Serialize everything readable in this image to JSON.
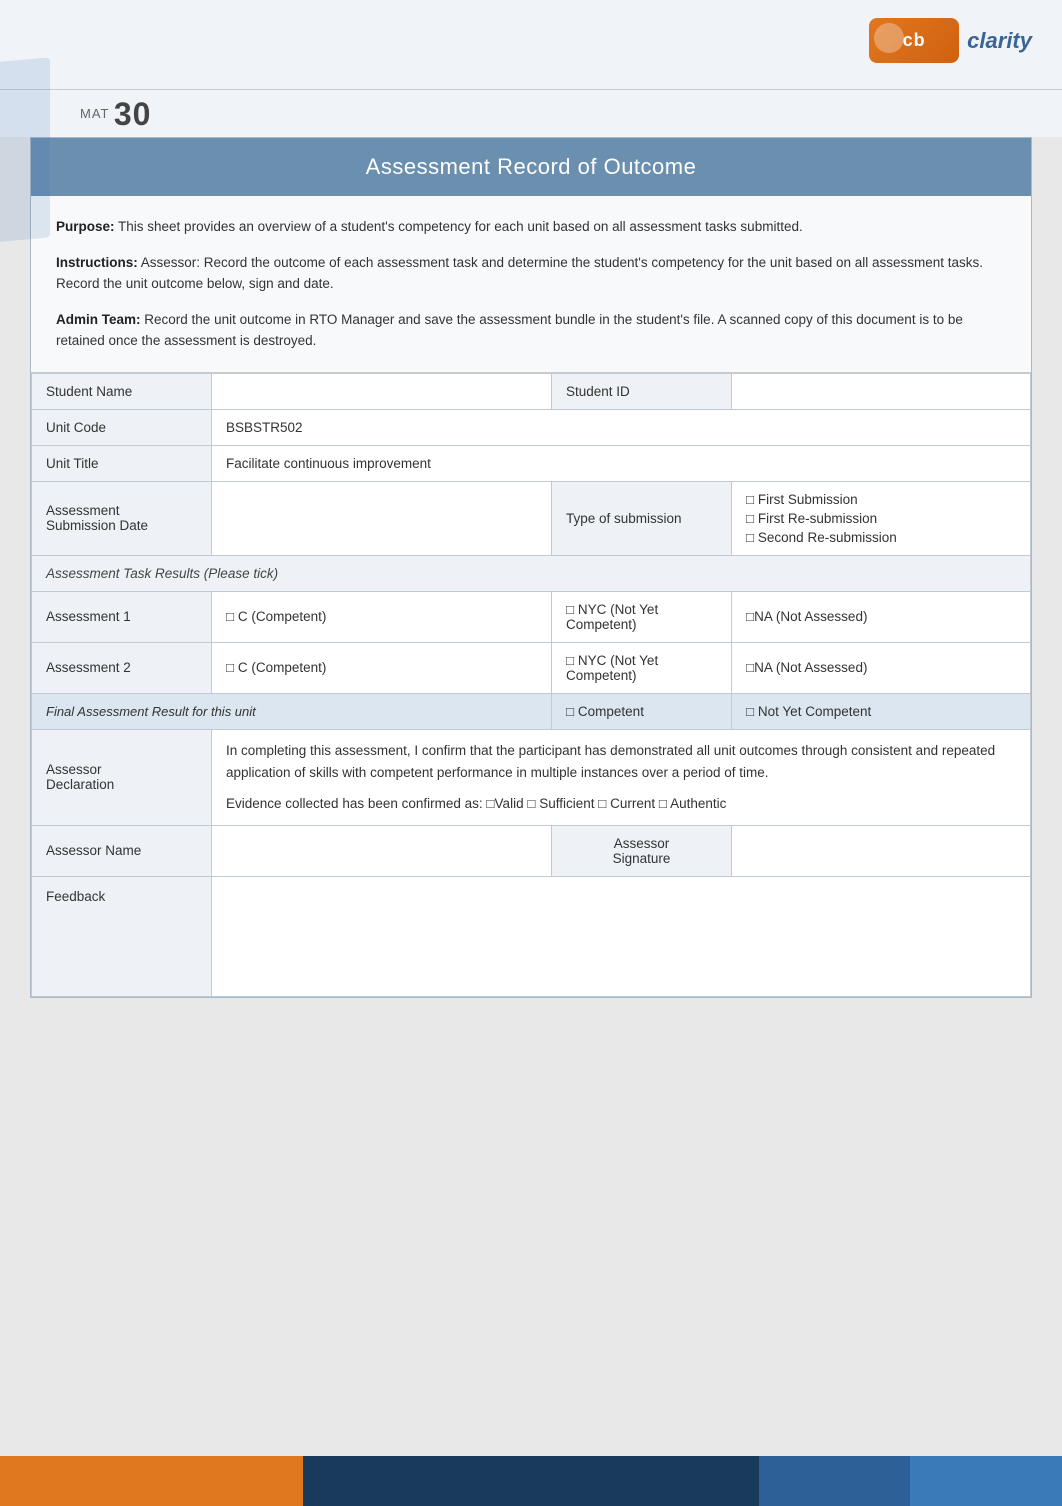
{
  "header": {
    "mat_label": "MAT",
    "mat_number": "30",
    "logo_text": "cb",
    "logo_name": "clarity"
  },
  "title": "Assessment Record of Outcome",
  "info": {
    "purpose_label": "Purpose:",
    "purpose_text": "  This sheet provides an overview of a student's competency for each unit based on all assessment tasks submitted.",
    "instructions_label": "Instructions:",
    "instructions_text": " Assessor: Record the outcome of each assessment task and determine the student's competency for the unit based on all assessment tasks. Record the unit outcome below, sign and date.",
    "admin_label": "Admin Team:",
    "admin_text": "   Record the unit outcome in RTO Manager and save the assessment bundle in the student's file. A scanned copy of this document is to be retained once the assessment is destroyed."
  },
  "form": {
    "student_name_label": "Student Name",
    "student_id_label": "Student ID",
    "unit_code_label": "Unit Code",
    "unit_code_value": "BSBSTR502",
    "unit_title_label": "Unit Title",
    "unit_title_value": "Facilitate continuous improvement",
    "assessment_submission_date_label": "Assessment\nSubmission Date",
    "type_of_submission_label": "Type of submission",
    "first_submission": "□ First Submission",
    "first_resubmission": "□ First Re-submission",
    "second_resubmission": "□ Second Re-submission",
    "task_results_header": "Assessment Task Results (Please tick)",
    "assessment1_label": "Assessment 1",
    "assessment1_competent": "□ C (Competent)",
    "assessment1_nyc": "□ NYC (Not Yet Competent)",
    "assessment1_na": "□NA (Not Assessed)",
    "assessment2_label": "Assessment 2",
    "assessment2_competent": "□ C (Competent)",
    "assessment2_nyc": "□ NYC (Not Yet Competent)",
    "assessment2_na": "□NA (Not Assessed)",
    "final_result_label": "Final Assessment Result for this unit",
    "final_competent": "□ Competent",
    "final_nyc": "□ Not Yet Competent",
    "assessor_decl_label": "Assessor\nDeclaration",
    "assessor_decl_text1": "In completing this assessment, I confirm that the participant has demonstrated all unit outcomes through consistent and repeated application of skills with competent performance in multiple instances over a period of time.",
    "assessor_decl_text2": "Evidence collected has been confirmed as: □Valid        □ Sufficient   □ Current   □ Authentic",
    "assessor_name_label": "Assessor Name",
    "assessor_signature_label": "Assessor\nSignature",
    "feedback_label": "Feedback"
  }
}
